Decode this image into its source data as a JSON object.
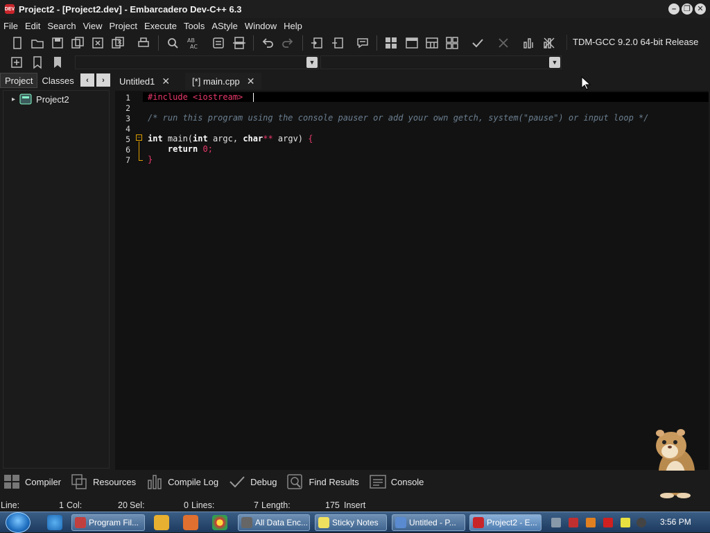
{
  "window": {
    "app_icon_text": "DEV",
    "title": "Project2 - [Project2.dev] - Embarcadero Dev-C++ 6.3",
    "min_label": "–",
    "restore_label": "❐",
    "close_label": "✕"
  },
  "menu": [
    "File",
    "Edit",
    "Search",
    "View",
    "Project",
    "Execute",
    "Tools",
    "AStyle",
    "Window",
    "Help"
  ],
  "toolbar": {
    "compiler": "TDM-GCC 9.2.0 64-bit Release",
    "icons": [
      "new-file-icon",
      "open-icon",
      "save-icon",
      "save-all-icon",
      "close-icon",
      "close-all-icon",
      "print-icon",
      "find-icon",
      "replace-icon",
      "goto-icon",
      "toggle-icon",
      "undo-icon",
      "redo-icon",
      "indent-icon",
      "unindent-icon",
      "toggle-comment-icon",
      "compile-icon",
      "run-icon",
      "compile-run-icon",
      "rebuild-icon",
      "syntax-check-icon",
      "stop-icon",
      "profile-icon",
      "delete-profile-icon"
    ]
  },
  "left_panel": {
    "tabs": [
      "Project",
      "Classes"
    ],
    "prev_label": "‹",
    "next_label": "›",
    "tree": {
      "expander": "▸",
      "root": "Project2"
    }
  },
  "editor_tabs": [
    {
      "label": "Untitled1",
      "close": "✕"
    },
    {
      "label": "[*] main.cpp",
      "close": "✕"
    }
  ],
  "code": {
    "line_numbers": [
      "1",
      "2",
      "3",
      "4",
      "5",
      "6",
      "7"
    ],
    "line1": {
      "pp": "#include",
      "rest": " <iostream>"
    },
    "line3": "/* run this program using the console pauser or add your own getch, system(\"pause\") or input loop */",
    "line5": {
      "kw1": "int",
      "fn": " main(",
      "kw2": "int",
      "p1": " argc, ",
      "kw3": "char",
      "op": "**",
      "p2": " argv) ",
      "br": "{"
    },
    "line6": {
      "indent": "    ",
      "kw": "return",
      "space": " ",
      "num": "0",
      "semi": ";"
    },
    "line7": "}",
    "fold_symbol": "−"
  },
  "bottom_tabs": [
    "Compiler",
    "Resources",
    "Compile Log",
    "Debug",
    "Find Results",
    "Console"
  ],
  "status": {
    "line_label": "Line:",
    "line_value": "1",
    "col_label": "Col:",
    "col_value": "20",
    "sel_label": "Sel:",
    "sel_value": "0",
    "lines_label": "Lines:",
    "lines_value": "7",
    "length_label": "Length:",
    "length_value": "175",
    "mode": "Insert"
  },
  "taskbar": {
    "items": [
      "Program Fil...",
      "All Data Enc...",
      "Sticky Notes",
      "Untitled - P...",
      "Project2 - E..."
    ],
    "clock": "3:56 PM"
  }
}
